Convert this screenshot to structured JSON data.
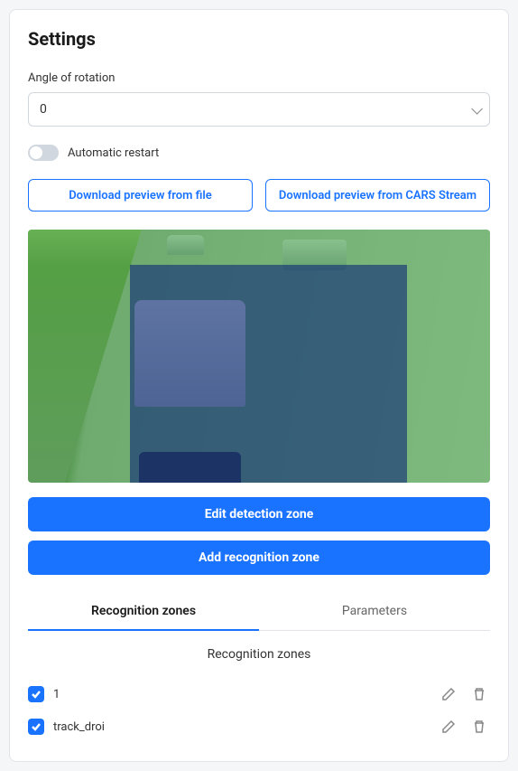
{
  "title": "Settings",
  "angle": {
    "label": "Angle of rotation",
    "value": "0"
  },
  "toggle": {
    "label": "Automatic restart",
    "on": false
  },
  "buttons": {
    "download_file": "Download preview from file",
    "download_stream": "Download preview from CARS Stream",
    "edit_zone": "Edit detection zone",
    "add_zone": "Add recognition zone"
  },
  "tabs": {
    "recognition": "Recognition zones",
    "parameters": "Parameters",
    "active": "recognition"
  },
  "section_title": "Recognition zones",
  "zones": [
    {
      "name": "1",
      "checked": true
    },
    {
      "name": "track_droi",
      "checked": true
    }
  ]
}
